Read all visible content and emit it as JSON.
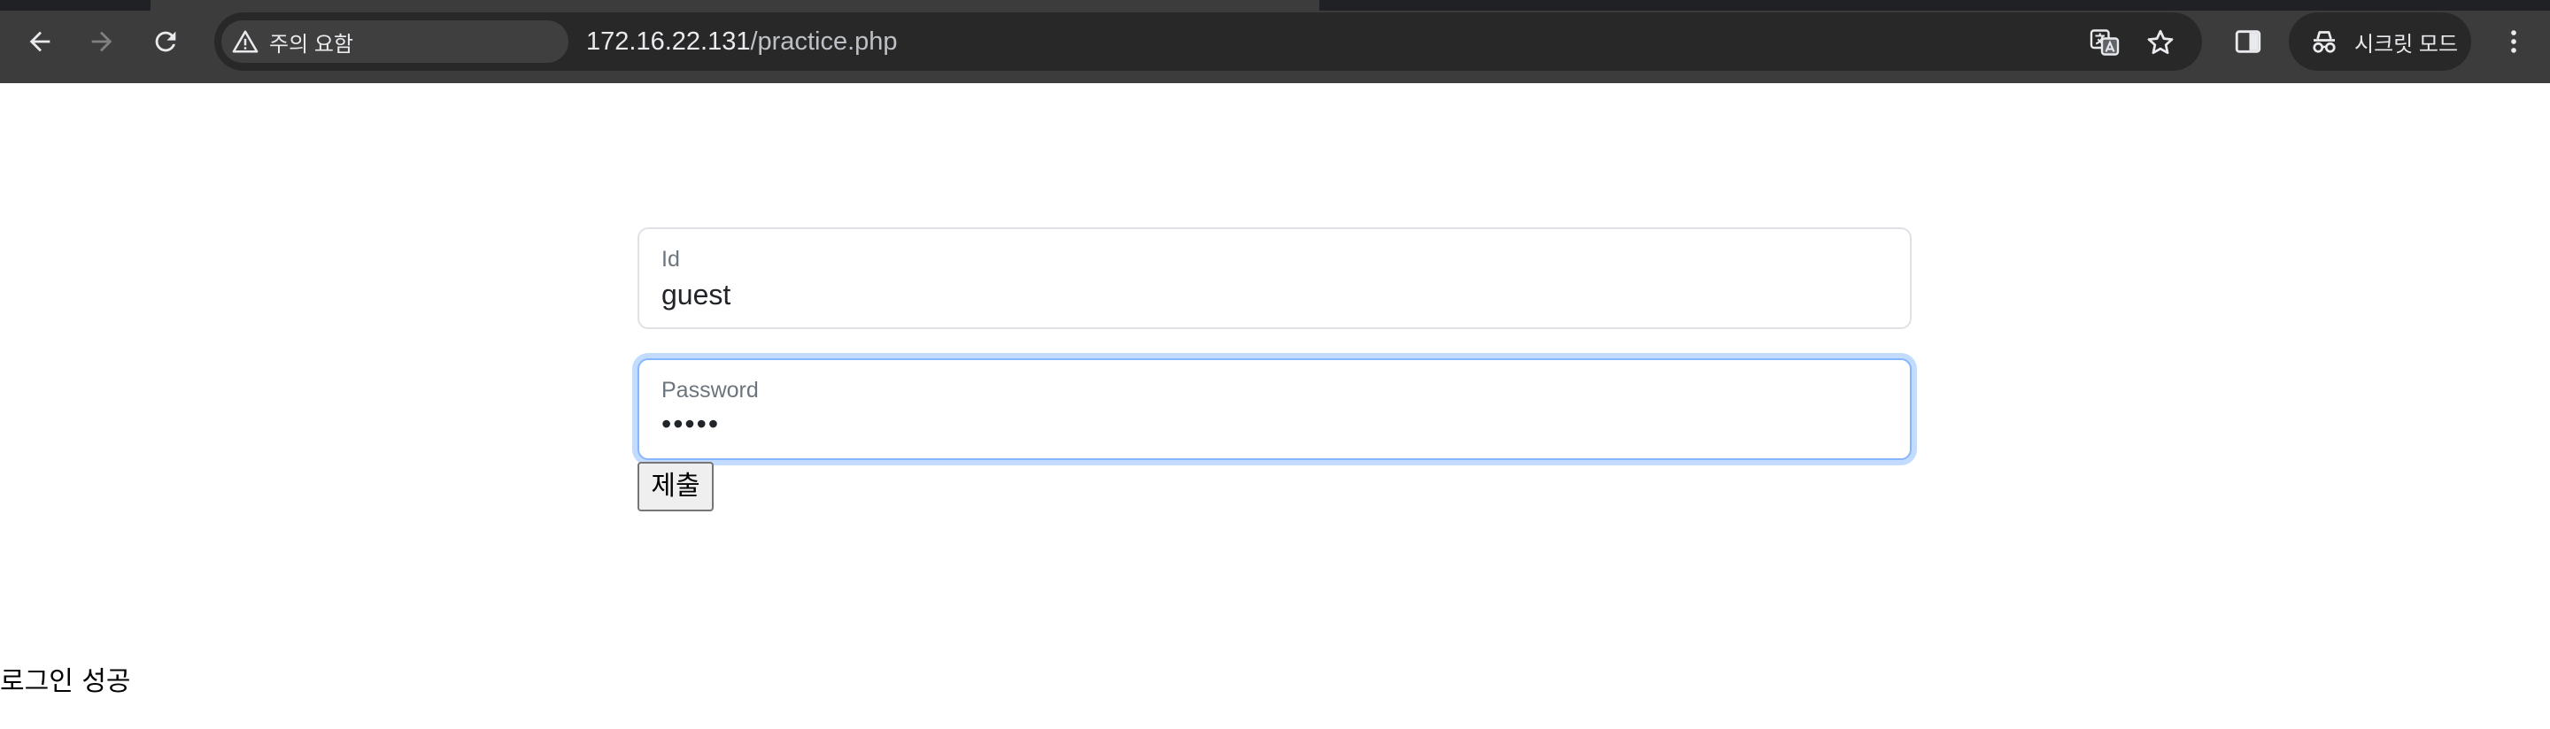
{
  "browser": {
    "security_chip": "주의 요함",
    "url_host": "172.16.22.131",
    "url_path": "/practice.php",
    "incognito_label": "시크릿 모드",
    "icons": [
      "back-arrow-icon",
      "forward-arrow-icon",
      "reload-icon",
      "warning-triangle-icon",
      "translate-icon",
      "star-icon",
      "side-panel-icon",
      "incognito-icon",
      "kebab-menu-icon"
    ],
    "colors": {
      "toolbar": "#3c3c3c",
      "omnibox": "#282828",
      "text": "#e8eaed"
    }
  },
  "form": {
    "id_label": "Id",
    "id_value": "guest",
    "password_label": "Password",
    "password_value": "•••••",
    "submit_label": "제출",
    "colors": {
      "focus_border": "#86b7fe",
      "border": "#dee2e6",
      "label": "#6c757d"
    }
  },
  "result": {
    "message": "로그인 성공"
  }
}
